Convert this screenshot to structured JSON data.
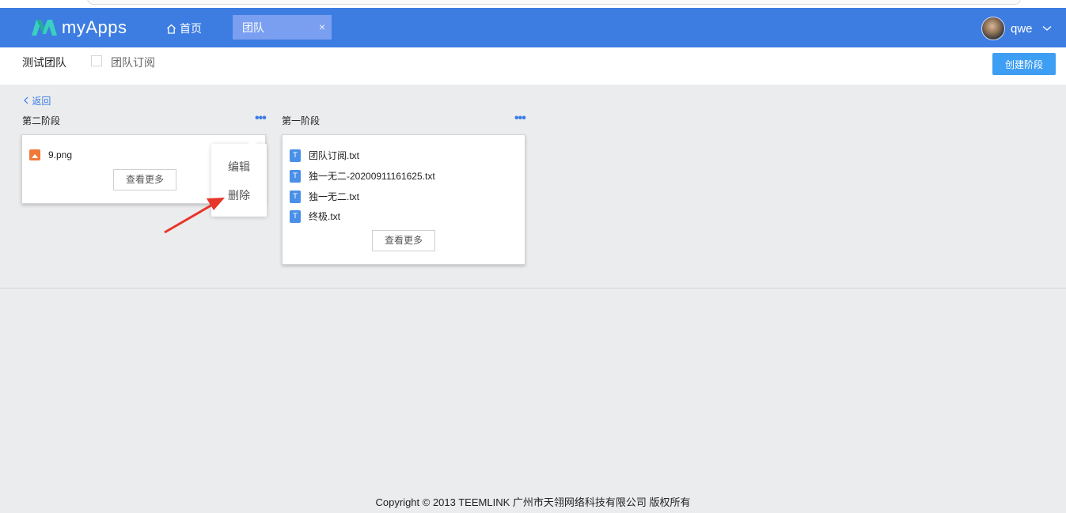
{
  "app": {
    "brand": "myApps",
    "accent_color": "#3d7de2"
  },
  "nav": {
    "home_label": "首页",
    "active_tab_label": "团队",
    "close_symbol": "×",
    "user_name": "qwe"
  },
  "subbar": {
    "team_name": "测试团队",
    "subscribe_label": "团队订阅",
    "create_stage_label": "创建阶段"
  },
  "back_label": "返回",
  "stages": [
    {
      "title": "第二阶段",
      "files": [
        {
          "name": "9.png",
          "icon": "image-file-icon"
        }
      ],
      "more_label": "查看更多"
    },
    {
      "title": "第一阶段",
      "files": [
        {
          "name": "团队订阅.txt",
          "icon": "text-file-icon"
        },
        {
          "name": "独一无二-20200911161625.txt",
          "icon": "text-file-icon"
        },
        {
          "name": "独一无二.txt",
          "icon": "text-file-icon"
        },
        {
          "name": "终极.txt",
          "icon": "text-file-icon"
        }
      ],
      "more_label": "查看更多"
    }
  ],
  "context_menu": {
    "edit_label": "编辑",
    "delete_label": "删除"
  },
  "footer": "Copyright © 2013 TEEMLINK 广州市天翎网络科技有限公司 版权所有"
}
